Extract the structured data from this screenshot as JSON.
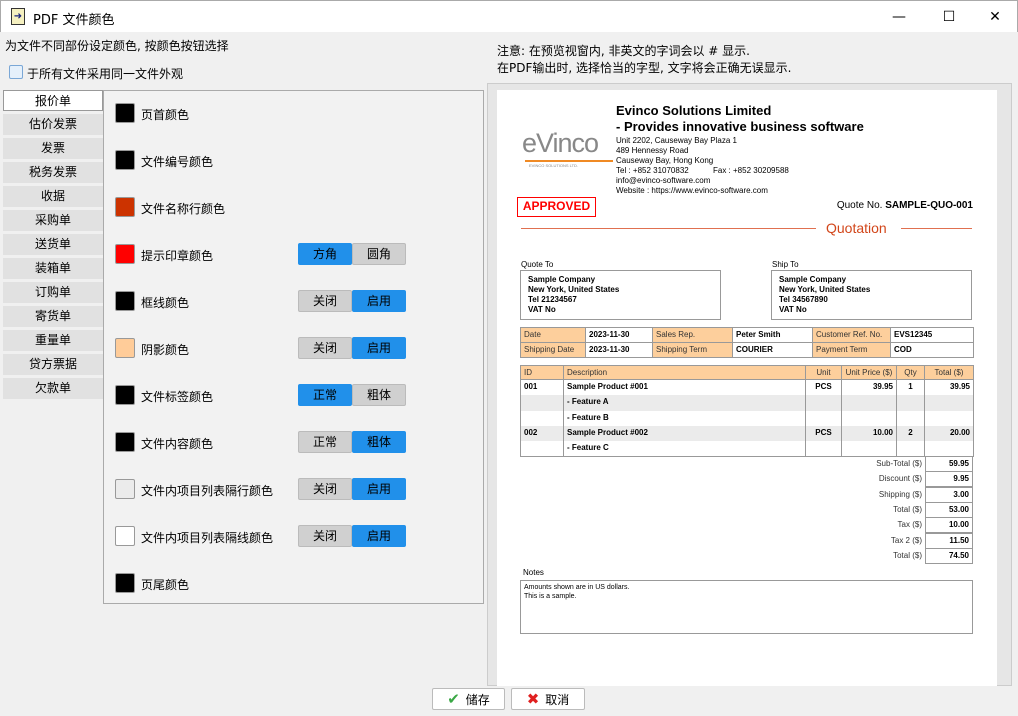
{
  "window": {
    "title": "PDF 文件颜色",
    "minimize": "—",
    "maximize": "☐",
    "close": "✕"
  },
  "instructions": "为文件不同部份设定颜色, 按颜色按钮选择",
  "same_look_checkbox": {
    "label": "于所有文件采用同一文件外观",
    "checked": false
  },
  "note": [
    "注意: 在预览视窗内, 非英文的字词会以 # 显示.",
    "在PDF输出时, 选择恰当的字型, 文字将会正确无误显示."
  ],
  "doc_tabs": [
    "报价单",
    "估价发票",
    "发票",
    "税务发票",
    "收据",
    "采购单",
    "送货单",
    "装箱单",
    "订购单",
    "寄货单",
    "重量单",
    "贷方票据",
    "欠款单"
  ],
  "selected_tab": 0,
  "color_rows": [
    {
      "label": "页首颜色",
      "color": "#000000"
    },
    {
      "label": "文件编号颜色",
      "color": "#000000"
    },
    {
      "label": "文件名称行颜色",
      "color": "#cc3300"
    },
    {
      "label": "提示印章颜色",
      "color": "#ff0000",
      "options": [
        "方角",
        "圆角"
      ],
      "selected": 0
    },
    {
      "label": "框线颜色",
      "color": "#000000",
      "options": [
        "关闭",
        "启用"
      ],
      "selected": 1
    },
    {
      "label": "阴影颜色",
      "color": "#ffcc99",
      "options": [
        "关闭",
        "启用"
      ],
      "selected": 1
    },
    {
      "label": "文件标签颜色",
      "color": "#000000",
      "options": [
        "正常",
        "粗体"
      ],
      "selected": 0
    },
    {
      "label": "文件内容颜色",
      "color": "#000000",
      "options": [
        "正常",
        "粗体"
      ],
      "selected": 1
    },
    {
      "label": "文件内项目列表隔行颜色",
      "color": "#ebebeb",
      "options": [
        "关闭",
        "启用"
      ],
      "selected": 1
    },
    {
      "label": "文件内项目列表隔线颜色",
      "color": "#ffffff",
      "options": [
        "关闭",
        "启用"
      ],
      "selected": 1
    },
    {
      "label": "页尾颜色",
      "color": "#000000"
    }
  ],
  "preview": {
    "logo": "eVinco",
    "logo_sub": "EVINCO SOLUTIONS LTD.",
    "company": "Evinco Solutions Limited",
    "tagline": "- Provides innovative business software",
    "address": [
      "Unit 2202, Causeway Bay Plaza 1",
      "489 Hennessy Road",
      "Causeway Bay, Hong Kong"
    ],
    "tel": "Tel : +852 31070832",
    "fax": "Fax : +852 30209588",
    "email": "info@evinco-software.com",
    "website": "Website : https://www.evinco-software.com",
    "stamp": "APPROVED",
    "quote_no_label": "Quote No.",
    "quote_no": "SAMPLE-QUO-001",
    "doc_title": "Quotation",
    "quote_to": {
      "label": "Quote To",
      "lines": [
        "Sample Company",
        "New York, United States",
        "Tel 21234567",
        "VAT No"
      ]
    },
    "ship_to": {
      "label": "Ship To",
      "lines": [
        "Sample Company",
        "New York, United States",
        "Tel 34567890",
        "VAT No"
      ]
    },
    "info": [
      [
        "Date",
        "2023-11-30",
        "Sales Rep.",
        "Peter Smith",
        "Customer Ref. No.",
        "EVS12345"
      ],
      [
        "Shipping Date",
        "2023-11-30",
        "Shipping Term",
        "COURIER",
        "Payment Term",
        "COD"
      ]
    ],
    "items_header": [
      "ID",
      "Description",
      "Unit",
      "Unit Price ($)",
      "Qty",
      "Total ($)"
    ],
    "items": [
      [
        "001",
        "Sample Product #001",
        "PCS",
        "39.95",
        "1",
        "39.95"
      ],
      [
        "",
        "- Feature A",
        "",
        "",
        "",
        ""
      ],
      [
        "",
        "- Feature B",
        "",
        "",
        "",
        ""
      ],
      [
        "002",
        "Sample Product #002",
        "PCS",
        "10.00",
        "2",
        "20.00"
      ],
      [
        "",
        "- Feature C",
        "",
        "",
        "",
        ""
      ]
    ],
    "totals": [
      [
        "Sub-Total ($)",
        "59.95"
      ],
      [
        "Discount ($)",
        "9.95"
      ],
      [
        "Shipping ($)",
        "3.00"
      ],
      [
        "Total ($)",
        "53.00"
      ],
      [
        "Tax ($)",
        "10.00"
      ],
      [
        "Tax 2 ($)",
        "11.50"
      ],
      [
        "Total ($)",
        "74.50"
      ]
    ],
    "notes_label": "Notes",
    "notes": [
      "Amounts shown are in US dollars.",
      "This is a sample."
    ]
  },
  "buttons": {
    "save": "储存",
    "cancel": "取消"
  }
}
